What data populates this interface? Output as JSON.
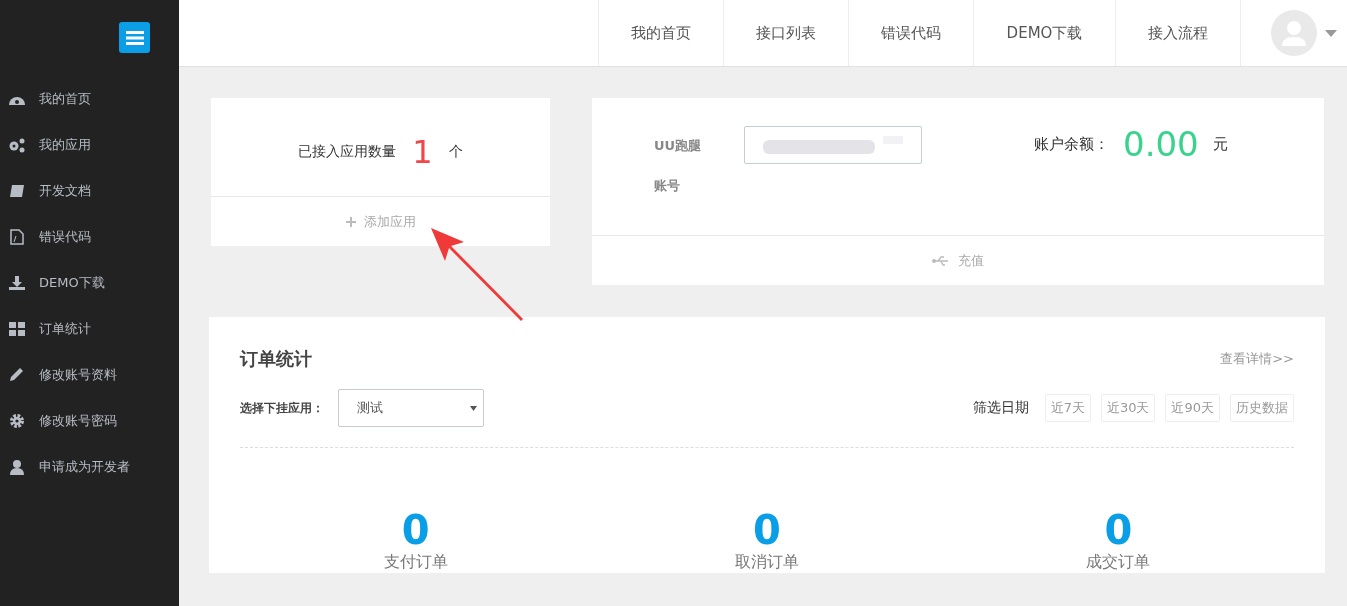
{
  "sidebar": {
    "items": [
      {
        "label": "我的首页",
        "selected": false
      },
      {
        "label": "我的应用",
        "selected": false
      },
      {
        "label": "开发文档",
        "selected": false
      },
      {
        "label": "错误代码",
        "selected": false
      },
      {
        "label": "DEMO下载",
        "selected": false
      },
      {
        "label": "订单统计",
        "selected": false
      },
      {
        "label": "修改账号资料",
        "selected": false
      },
      {
        "label": "修改账号密码",
        "selected": false
      },
      {
        "label": "申请成为开发者",
        "selected": false
      }
    ]
  },
  "topnav": {
    "items": [
      "我的首页",
      "接口列表",
      "错误代码",
      "DEMO下载",
      "接入流程"
    ]
  },
  "apps_card": {
    "label": "已接入应用数量",
    "count": "1",
    "unit": "个",
    "action": "添加应用"
  },
  "account_card": {
    "account_label": "UU跑腿账号",
    "balance_label": "账户余额：",
    "balance": "0.00",
    "currency": "元",
    "action": "充值"
  },
  "orders": {
    "title": "订单统计",
    "details_link": "查看详情>>",
    "select_label": "选择下挂应用：",
    "select_value": "测试",
    "filter_label": "筛选日期",
    "filters": [
      {
        "label": "近7天",
        "selected": false
      },
      {
        "label": "近30天",
        "selected": false
      },
      {
        "label": "近90天",
        "selected": false
      },
      {
        "label": "历史数据",
        "selected": false
      }
    ],
    "stats": [
      {
        "value": "0",
        "label": "支付订单"
      },
      {
        "value": "0",
        "label": "取消订单"
      },
      {
        "value": "0",
        "label": "成交订单"
      }
    ]
  }
}
